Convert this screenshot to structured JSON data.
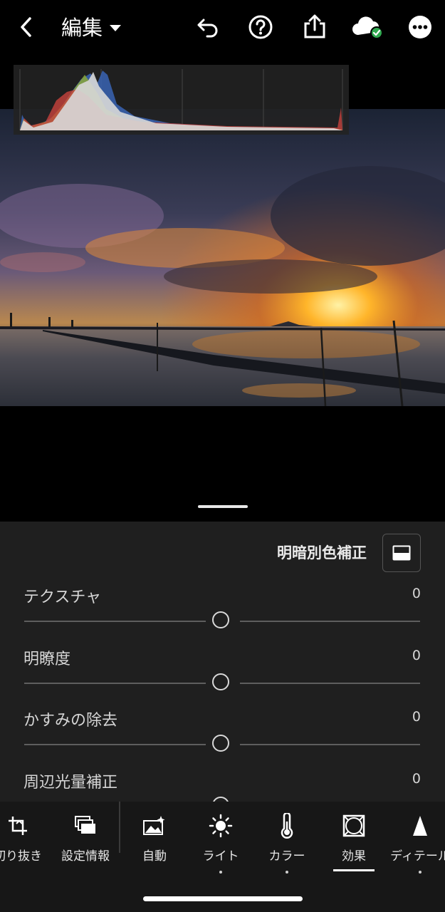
{
  "header": {
    "title": "編集",
    "icons": [
      "back-chevron-icon",
      "undo-icon",
      "help-icon",
      "share-icon",
      "cloud-synced-icon",
      "more-icon"
    ],
    "sync_badge_color": "#2fa84f"
  },
  "histogram": {
    "channels": [
      "red",
      "green",
      "blue",
      "luminance"
    ],
    "colors": {
      "red": "#c8423c",
      "green": "#8aa83a",
      "blue": "#3a64b4",
      "luminance": "#d8d8d8"
    }
  },
  "panel": {
    "title": "明暗別色補正",
    "sliders": [
      {
        "label": "テクスチャ",
        "value": "0"
      },
      {
        "label": "明瞭度",
        "value": "0"
      },
      {
        "label": "かすみの除去",
        "value": "0"
      },
      {
        "label": "周辺光量補正",
        "value": "0"
      }
    ]
  },
  "toolbar": {
    "items": [
      {
        "label": "切り抜き",
        "icon": "crop-icon"
      },
      {
        "label": "設定情報",
        "icon": "presets-icon"
      },
      {
        "label": "自動",
        "icon": "auto-icon"
      },
      {
        "label": "ライト",
        "icon": "light-icon"
      },
      {
        "label": "カラー",
        "icon": "color-thermometer-icon"
      },
      {
        "label": "効果",
        "icon": "effects-icon",
        "selected": true
      },
      {
        "label": "ディテール",
        "icon": "detail-icon"
      }
    ]
  }
}
